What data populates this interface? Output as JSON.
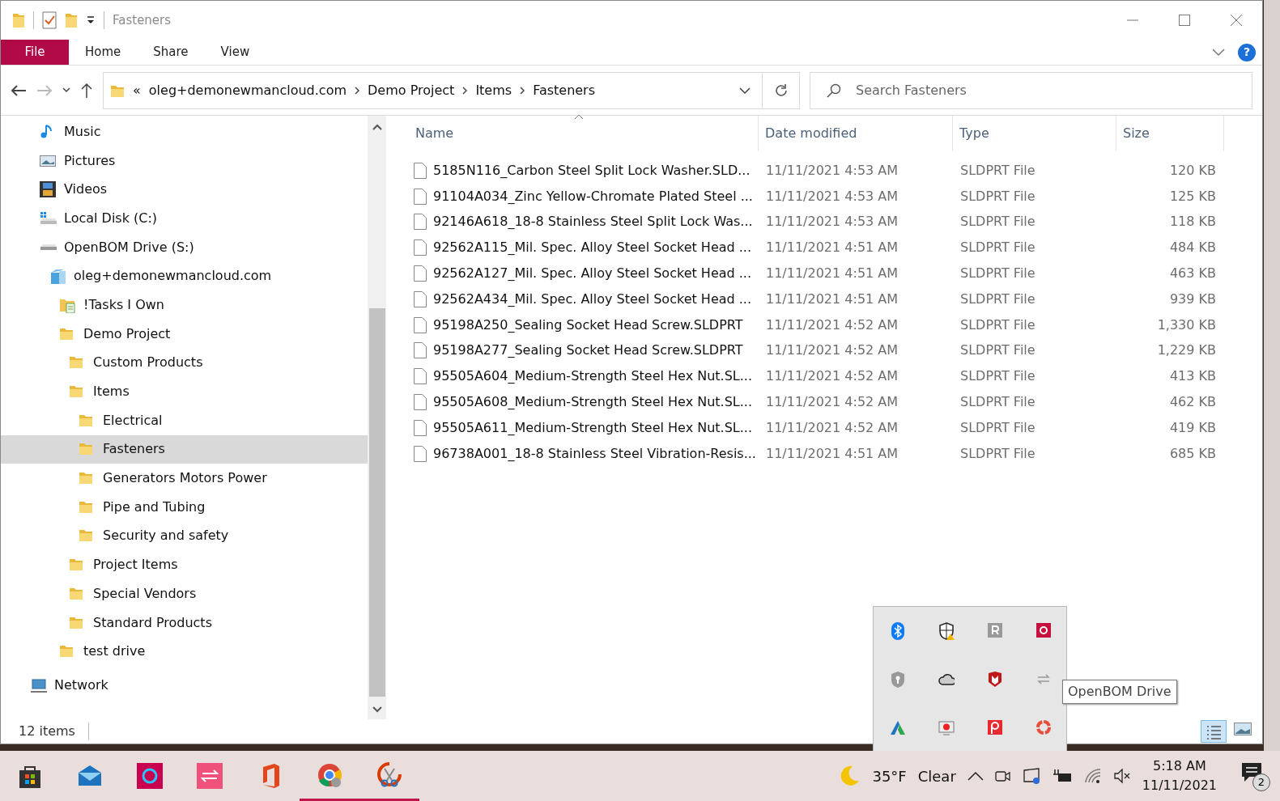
{
  "window": {
    "title": "Fasteners"
  },
  "ribbon": {
    "tabs": [
      {
        "label": "File",
        "kind": "app-menu"
      },
      {
        "label": "Home",
        "kind": "tab"
      },
      {
        "label": "Share",
        "kind": "tab"
      },
      {
        "label": "View",
        "kind": "tab"
      }
    ],
    "help": "?"
  },
  "address_bar": {
    "overflow": "«",
    "crumbs": [
      "oleg+demonewmancloud.com",
      "Demo Project",
      "Items",
      "Fasteners"
    ]
  },
  "search": {
    "placeholder": "Search Fasteners"
  },
  "nav_tree": [
    {
      "label": "Music",
      "kind": "music",
      "selected": false
    },
    {
      "label": "Pictures",
      "kind": "pictures",
      "selected": false
    },
    {
      "label": "Videos",
      "kind": "videos",
      "selected": false
    },
    {
      "label": "Local Disk (C:)",
      "kind": "system-drive",
      "selected": false
    },
    {
      "label": "OpenBOM Drive (S:)",
      "kind": "drive",
      "selected": false,
      "children": [
        {
          "label": "oleg+demonewmancloud.com",
          "kind": "cloud-account",
          "selected": false,
          "children": [
            {
              "label": "!Tasks I Own",
              "kind": "task-folder",
              "selected": false
            },
            {
              "label": "Demo Project",
              "kind": "folder",
              "selected": false,
              "children": [
                {
                  "label": "Custom Products",
                  "kind": "folder",
                  "selected": false
                },
                {
                  "label": "Items",
                  "kind": "folder",
                  "selected": false,
                  "children": [
                    {
                      "label": "Electrical",
                      "kind": "folder",
                      "selected": false
                    },
                    {
                      "label": "Fasteners",
                      "kind": "folder",
                      "selected": true
                    },
                    {
                      "label": "Generators Motors Power",
                      "kind": "folder",
                      "selected": false
                    },
                    {
                      "label": "Pipe and Tubing",
                      "kind": "folder",
                      "selected": false
                    },
                    {
                      "label": "Security and safety",
                      "kind": "folder",
                      "selected": false
                    }
                  ]
                },
                {
                  "label": "Project Items",
                  "kind": "folder",
                  "selected": false
                },
                {
                  "label": "Special Vendors",
                  "kind": "folder",
                  "selected": false
                },
                {
                  "label": "Standard Products",
                  "kind": "folder",
                  "selected": false
                }
              ]
            },
            {
              "label": "test drive",
              "kind": "folder",
              "selected": false
            }
          ]
        }
      ]
    }
  ],
  "network": {
    "label": "Network"
  },
  "file_list": {
    "columns": [
      {
        "label": "Name",
        "sorted": true
      },
      {
        "label": "Date modified"
      },
      {
        "label": "Type"
      },
      {
        "label": "Size"
      }
    ],
    "rows": [
      {
        "name": "5185N116_Carbon Steel Split Lock Washer.SLD...",
        "date": "11/11/2021 4:53 AM",
        "type": "SLDPRT File",
        "size": "120 KB"
      },
      {
        "name": "91104A034_Zinc Yellow-Chromate Plated Steel ...",
        "date": "11/11/2021 4:53 AM",
        "type": "SLDPRT File",
        "size": "125 KB"
      },
      {
        "name": "92146A618_18-8 Stainless Steel Split Lock Was...",
        "date": "11/11/2021 4:53 AM",
        "type": "SLDPRT File",
        "size": "118 KB"
      },
      {
        "name": "92562A115_Mil. Spec. Alloy Steel Socket Head ...",
        "date": "11/11/2021 4:51 AM",
        "type": "SLDPRT File",
        "size": "484 KB"
      },
      {
        "name": "92562A127_Mil. Spec. Alloy Steel Socket Head ...",
        "date": "11/11/2021 4:51 AM",
        "type": "SLDPRT File",
        "size": "463 KB"
      },
      {
        "name": "92562A434_Mil. Spec. Alloy Steel Socket Head ...",
        "date": "11/11/2021 4:51 AM",
        "type": "SLDPRT File",
        "size": "939 KB"
      },
      {
        "name": "95198A250_Sealing Socket Head Screw.SLDPRT",
        "date": "11/11/2021 4:52 AM",
        "type": "SLDPRT File",
        "size": "1,330 KB"
      },
      {
        "name": "95198A277_Sealing Socket Head Screw.SLDPRT",
        "date": "11/11/2021 4:52 AM",
        "type": "SLDPRT File",
        "size": "1,229 KB"
      },
      {
        "name": "95505A604_Medium-Strength Steel Hex Nut.SL...",
        "date": "11/11/2021 4:52 AM",
        "type": "SLDPRT File",
        "size": "413 KB"
      },
      {
        "name": "95505A608_Medium-Strength Steel Hex Nut.SL...",
        "date": "11/11/2021 4:52 AM",
        "type": "SLDPRT File",
        "size": "462 KB"
      },
      {
        "name": "95505A611_Medium-Strength Steel Hex Nut.SL...",
        "date": "11/11/2021 4:52 AM",
        "type": "SLDPRT File",
        "size": "419 KB"
      },
      {
        "name": "96738A001_18-8 Stainless Steel Vibration-Resis...",
        "date": "11/11/2021 4:51 AM",
        "type": "SLDPRT File",
        "size": "685 KB"
      }
    ]
  },
  "status_bar": {
    "count": "12 items",
    "views": [
      {
        "kind": "details",
        "selected": true
      },
      {
        "kind": "large-icons",
        "selected": false
      }
    ]
  },
  "tray_popup": {
    "tooltip": "OpenBOM Drive"
  },
  "taskbar": {
    "apps": [
      {
        "running": false
      },
      {
        "running": false
      },
      {
        "running": false
      },
      {
        "running": false
      },
      {
        "running": false
      },
      {
        "running": true
      },
      {
        "running": true
      }
    ],
    "temperature": "35°F",
    "weather": "Clear",
    "time": "5:18 AM",
    "date": "11/11/2021",
    "notifications": "2"
  }
}
